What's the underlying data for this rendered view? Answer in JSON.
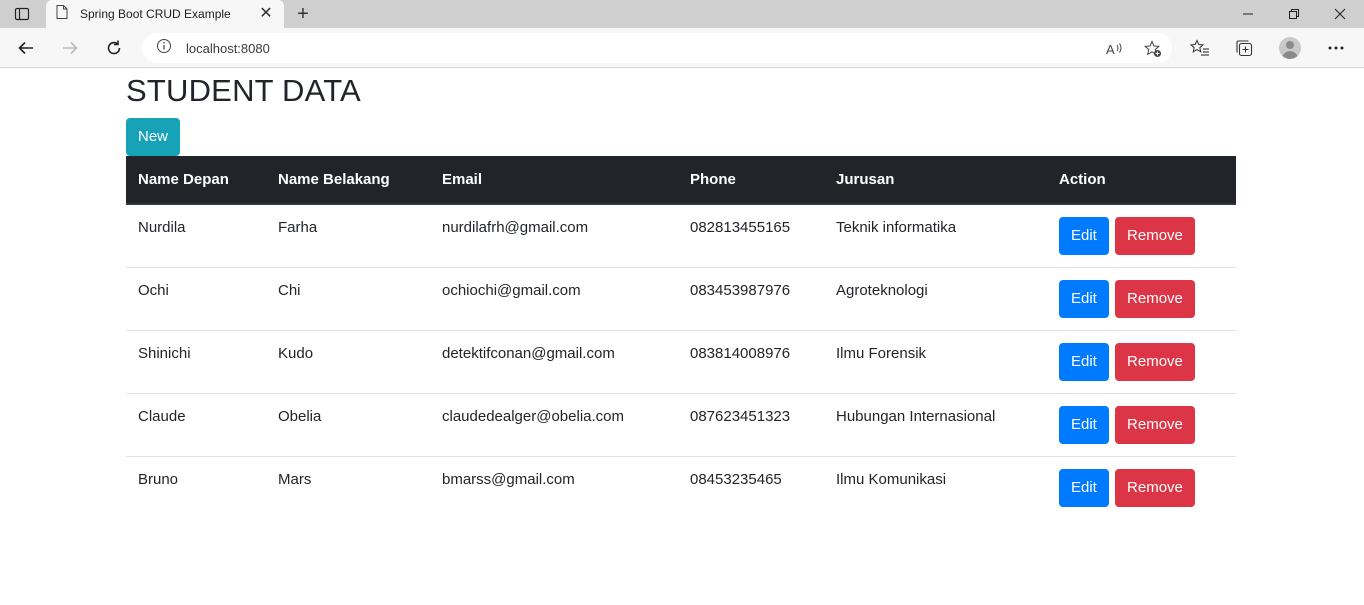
{
  "browser": {
    "tab_title": "Spring Boot CRUD Example",
    "tab_close": "✕",
    "new_tab": "+",
    "url": "localhost:8080"
  },
  "page": {
    "title": "STUDENT DATA",
    "new_button": "New"
  },
  "table": {
    "headers": [
      "Name Depan",
      "Name Belakang",
      "Email",
      "Phone",
      "Jurusan",
      "Action"
    ],
    "rows": [
      {
        "first": "Nurdila",
        "last": "Farha",
        "email": "nurdilafrh@gmail.com",
        "phone": "082813455165",
        "major": "Teknik informatika"
      },
      {
        "first": "Ochi",
        "last": "Chi",
        "email": "ochiochi@gmail.com",
        "phone": "083453987976",
        "major": "Agroteknologi"
      },
      {
        "first": "Shinichi",
        "last": "Kudo",
        "email": "detektifconan@gmail.com",
        "phone": "083814008976",
        "major": "Ilmu Forensik"
      },
      {
        "first": "Claude",
        "last": "Obelia",
        "email": "claudedealger@obelia.com",
        "phone": "087623451323",
        "major": "Hubungan Internasional"
      },
      {
        "first": "Bruno",
        "last": "Mars",
        "email": "bmarss@gmail.com",
        "phone": "08453235465",
        "major": "Ilmu Komunikasi"
      }
    ],
    "edit_label": "Edit",
    "remove_label": "Remove"
  },
  "colors": {
    "header_bg": "#212529",
    "new_button": "#17a2b8",
    "edit_button": "#007bff",
    "remove_button": "#dc3545"
  },
  "icons": [
    "tab-actions-icon",
    "page-icon",
    "close-icon",
    "plus-icon",
    "minimize-icon",
    "restore-icon",
    "window-close-icon",
    "back-icon",
    "forward-icon",
    "refresh-icon",
    "info-icon",
    "read-aloud-icon",
    "add-favorite-icon",
    "favorites-icon",
    "collections-icon",
    "profile-icon",
    "more-icon"
  ]
}
